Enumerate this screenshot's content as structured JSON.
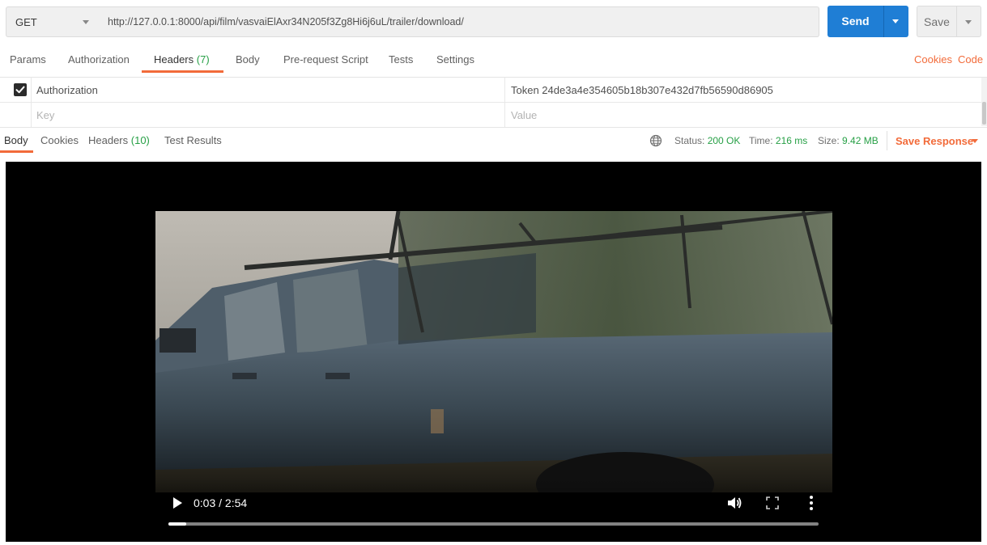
{
  "request": {
    "method": "GET",
    "url": "http://127.0.0.1:8000/api/film/vasvaiElAxr34N205f3Zg8Hi6j6uL/trailer/download/",
    "send_label": "Send",
    "save_label": "Save"
  },
  "request_tabs": [
    {
      "label": "Params"
    },
    {
      "label": "Authorization"
    },
    {
      "label": "Headers",
      "count": "(7)"
    },
    {
      "label": "Body"
    },
    {
      "label": "Pre-request Script"
    },
    {
      "label": "Tests"
    },
    {
      "label": "Settings"
    }
  ],
  "links": {
    "cookies": "Cookies",
    "code": "Code"
  },
  "headers_table": {
    "rows": [
      {
        "enabled": true,
        "key": "Authorization",
        "value": "Token 24de3a4e354605b18b307e432d7fb56590d86905"
      }
    ],
    "key_placeholder": "Key",
    "value_placeholder": "Value"
  },
  "response_tabs": [
    {
      "label": "Body"
    },
    {
      "label": "Cookies"
    },
    {
      "label": "Headers",
      "count": "(10)"
    },
    {
      "label": "Test Results"
    }
  ],
  "response_meta": {
    "status_label": "Status:",
    "status_value": "200 OK",
    "time_label": "Time:",
    "time_value": "216 ms",
    "size_label": "Size:",
    "size_value": "9.42 MB",
    "save_response": "Save Response"
  },
  "video": {
    "time_display": "0:03 / 2:54",
    "progress": 0.028
  },
  "colors": {
    "accent_orange": "#f26b3a",
    "send_blue": "#1f7ed5",
    "status_green": "#27a046"
  },
  "icons": [
    "chevron-down-icon",
    "checkbox-checked-icon",
    "globe-icon",
    "play-icon",
    "volume-icon",
    "fullscreen-icon",
    "more-vertical-icon"
  ]
}
